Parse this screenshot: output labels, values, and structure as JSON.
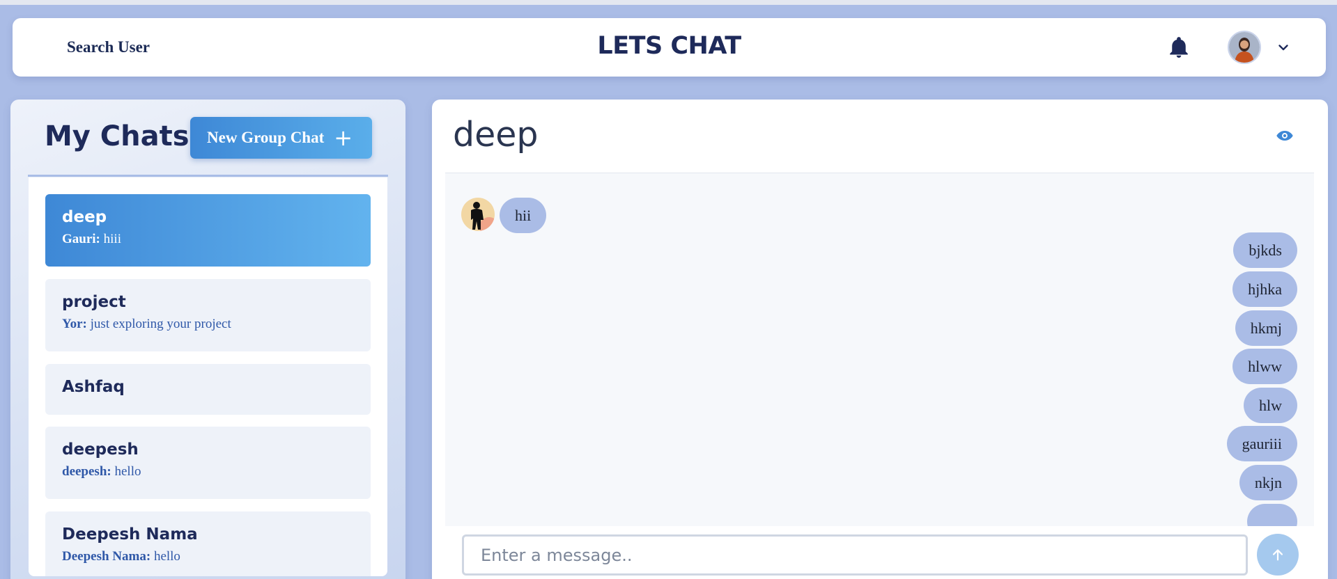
{
  "navbar": {
    "search_label": "Search User",
    "app_title": "LETS CHAT"
  },
  "sidebar": {
    "title": "My Chats",
    "new_group_label": "New Group Chat",
    "chats": [
      {
        "name": "deep",
        "sender": "Gauri:",
        "message": "hiii"
      },
      {
        "name": "project",
        "sender": "Yor:",
        "message": "just exploring your project"
      },
      {
        "name": "Ashfaq"
      },
      {
        "name": "deepesh",
        "sender": "deepesh:",
        "message": "hello"
      },
      {
        "name": "Deepesh Nama",
        "sender": "Deepesh Nama:",
        "message": "hello"
      }
    ]
  },
  "chat": {
    "title": "deep",
    "messages": [
      {
        "text": "hii",
        "side": "left"
      },
      {
        "text": "bjkds",
        "side": "right"
      },
      {
        "text": "hjhka",
        "side": "right"
      },
      {
        "text": "hkmj",
        "side": "right"
      },
      {
        "text": "hlww",
        "side": "right"
      },
      {
        "text": "hlw",
        "side": "right"
      },
      {
        "text": "gauriii",
        "side": "right"
      },
      {
        "text": "nkjn",
        "side": "right"
      }
    ],
    "input_placeholder": "Enter a message.."
  },
  "colors": {
    "page_bg": "#aabce6",
    "accent": "#3e88d6",
    "heading": "#1e2a5a",
    "bubble": "#aabce6"
  },
  "icons": [
    "bell-icon",
    "user-avatar",
    "chevron-down-icon",
    "plus-icon",
    "eye-icon",
    "arrow-up-icon"
  ]
}
